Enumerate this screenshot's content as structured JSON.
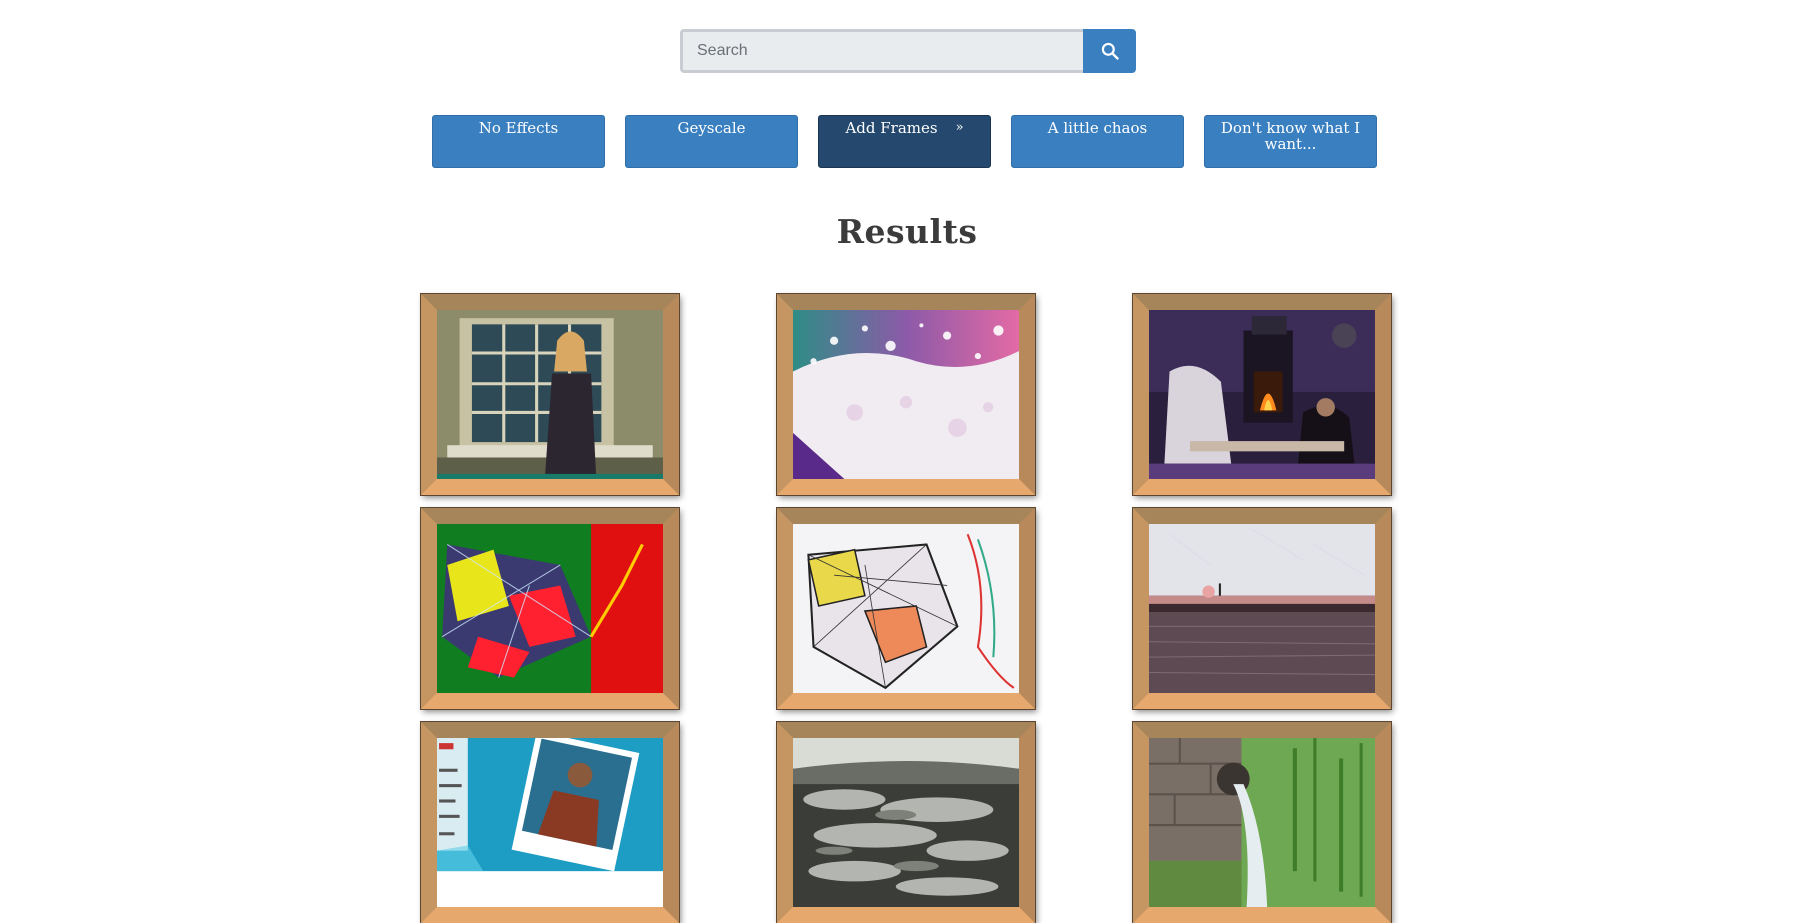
{
  "search": {
    "placeholder": "Search",
    "value": "",
    "icon": "search-icon"
  },
  "filters": [
    {
      "label": "No Effects",
      "active": false
    },
    {
      "label": "Geyscale",
      "active": false
    },
    {
      "label": "Add Frames",
      "chevron": "»",
      "active": true
    },
    {
      "label": "A little chaos",
      "active": false
    },
    {
      "label": "Don't know what I want...",
      "active": false
    }
  ],
  "results": {
    "title": "Results",
    "images": [
      {
        "subject": "woman-window-photo"
      },
      {
        "subject": "paint-splash-photo"
      },
      {
        "subject": "dark-fantasy-fireplace-photo"
      },
      {
        "subject": "neon-butterfly-photo"
      },
      {
        "subject": "sketch-butterfly-photo"
      },
      {
        "subject": "lake-pier-photo"
      },
      {
        "subject": "ocean-poster-photo"
      },
      {
        "subject": "rapids-water-photo"
      },
      {
        "subject": "waterfall-pipe-photo"
      }
    ]
  },
  "colors": {
    "button": "#3a80c1",
    "button_active": "#24486e",
    "frame_wood": "#c59562",
    "heading": "#3b3b3b"
  }
}
